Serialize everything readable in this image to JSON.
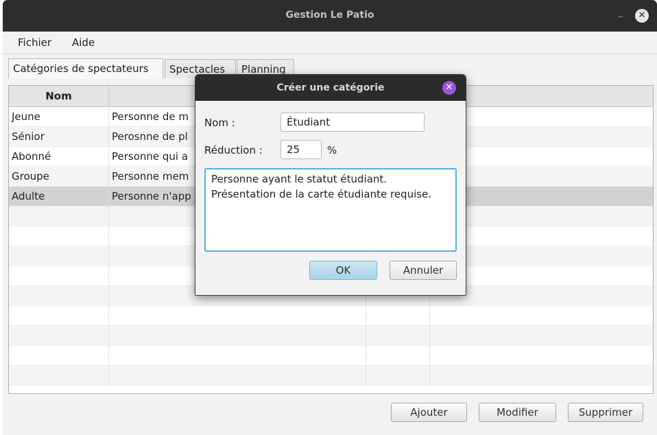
{
  "window": {
    "title": "Gestion Le Patio",
    "minimize_glyph": "–",
    "close_glyph": "✕"
  },
  "menubar": {
    "items": [
      "Fichier",
      "Aide"
    ]
  },
  "tabs": [
    "Catégories de spectateurs",
    "Spectacles",
    "Planning"
  ],
  "table": {
    "columns": [
      "Nom",
      "",
      "",
      ""
    ],
    "rows": [
      {
        "nom": "Jeune",
        "description": "Personne de m"
      },
      {
        "nom": "Sénior",
        "description": "Perosnne de pl"
      },
      {
        "nom": "Abonné",
        "description": "Personne qui a"
      },
      {
        "nom": "Groupe",
        "description": "Personne mem"
      },
      {
        "nom": "Adulte",
        "description": "Personne n'app"
      }
    ]
  },
  "buttons": {
    "add": "Ajouter",
    "edit": "Modifier",
    "delete": "Supprimer"
  },
  "dialog": {
    "title": "Créer une catégorie",
    "close_glyph": "✕",
    "nom_label": "Nom :",
    "nom_value": "Étudiant",
    "reduction_label": "Réduction :",
    "reduction_value": "25",
    "percent_sign": "%",
    "description_line1": "Personne ayant le statut étudiant.",
    "description_line2": "Présentation de la carte étudiante requise.",
    "ok_label": "OK",
    "cancel_label": "Annuler"
  },
  "colors": {
    "titlebar": "#2d2d2d",
    "dialog_close": "#9b59d8",
    "focus_border": "#4fb2e0",
    "selected_row": "#d2d2d2"
  }
}
